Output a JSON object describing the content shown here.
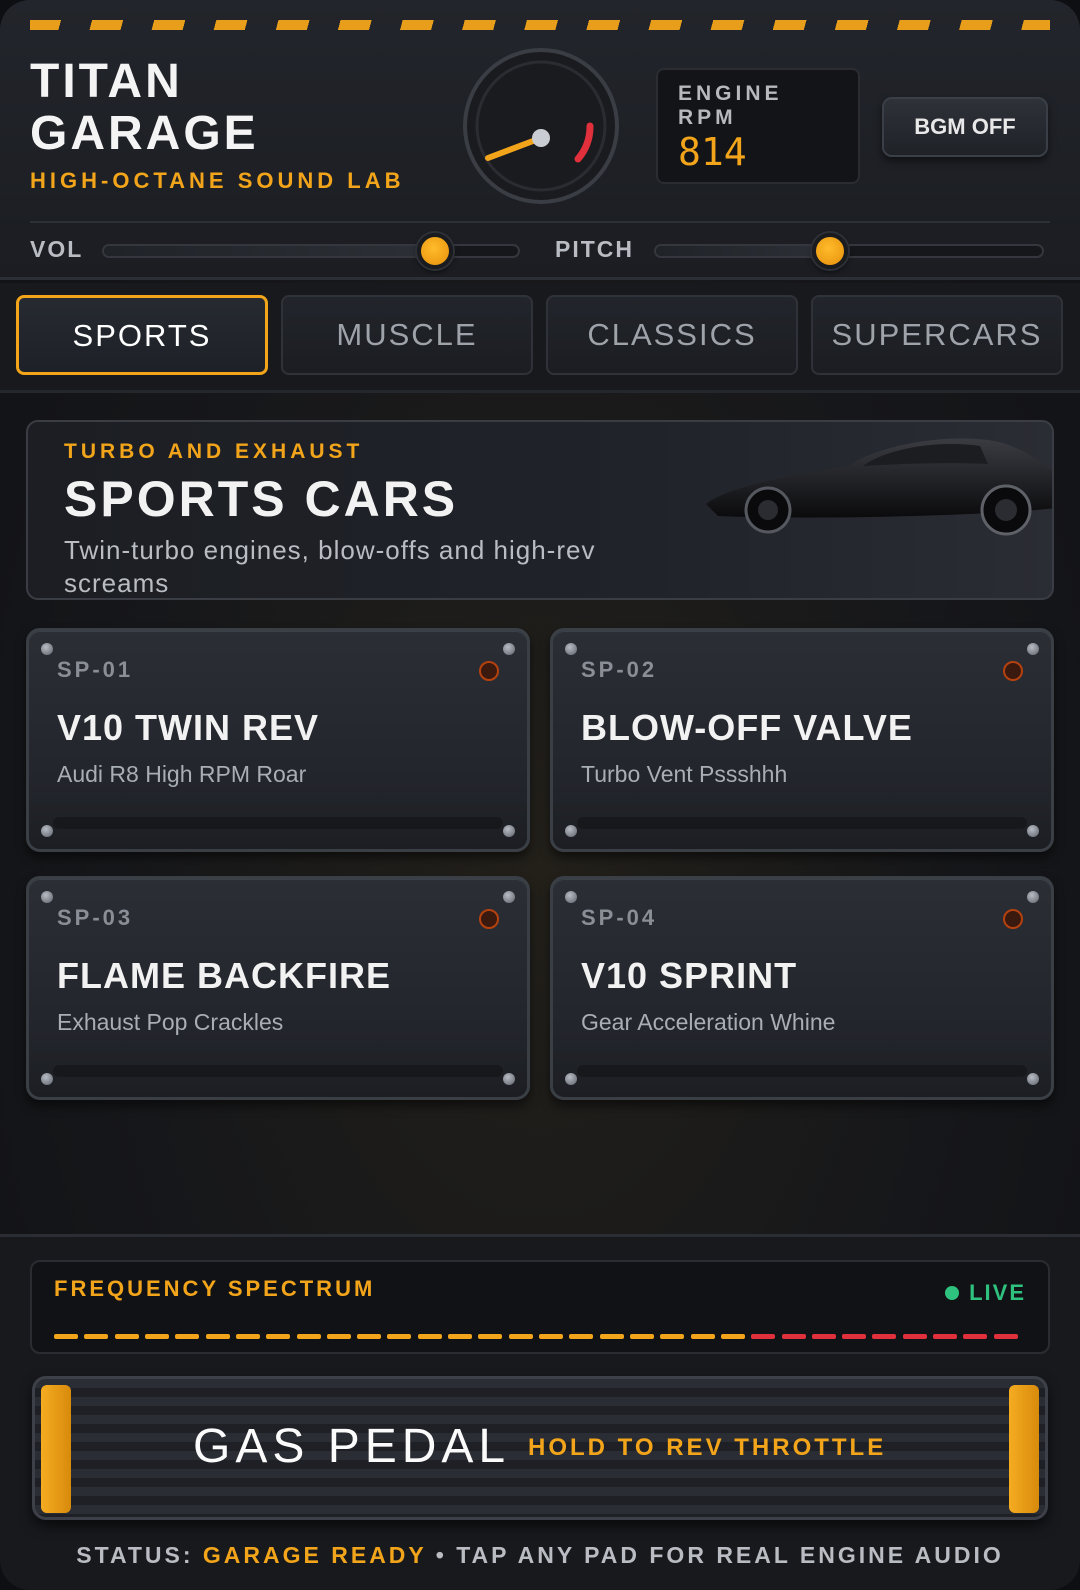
{
  "header": {
    "title_line1": "TITAN",
    "title_line2": "GARAGE",
    "subtitle": "HIGH-OCTANE SOUND LAB",
    "rpm_label": "ENGINE RPM",
    "rpm_value": "814",
    "bgm_button": "BGM OFF"
  },
  "controls": {
    "volume": {
      "label": "VOL",
      "level": 0.8
    },
    "pitch": {
      "label": "PITCH",
      "level": 0.45
    }
  },
  "tabs": [
    {
      "label": "SPORTS",
      "active": true
    },
    {
      "label": "MUSCLE",
      "active": false
    },
    {
      "label": "CLASSICS",
      "active": false
    },
    {
      "label": "SUPERCARS",
      "active": false
    }
  ],
  "hero": {
    "kicker": "TURBO AND EXHAUST",
    "title": "SPORTS CARS",
    "description": "Twin-turbo engines, blow-offs and high-rev screams"
  },
  "pads": [
    {
      "code": "SP-01",
      "name": "V10 TWIN REV",
      "description": "Audi R8 High RPM Roar"
    },
    {
      "code": "SP-02",
      "name": "BLOW-OFF VALVE",
      "description": "Turbo Vent Pssshhh"
    },
    {
      "code": "SP-03",
      "name": "FLAME BACKFIRE",
      "description": "Exhaust Pop Crackles"
    },
    {
      "code": "SP-04",
      "name": "V10 SPRINT",
      "description": "Gear Acceleration Whine"
    }
  ],
  "spectrum": {
    "label": "FREQUENCY SPECTRUM",
    "live_label": "LIVE",
    "bar_count": 32,
    "hot_from_index": 23
  },
  "pedal": {
    "label": "GAS PEDAL",
    "hint": "HOLD TO REV THROTTLE"
  },
  "status": {
    "prefix": "STATUS:",
    "state": "GARAGE READY",
    "separator": "•",
    "message": "TAP ANY PAD FOR REAL ENGINE AUDIO"
  },
  "colors": {
    "accent": "#f2a51a",
    "live": "#2ec27e",
    "redline": "#e0303b"
  }
}
